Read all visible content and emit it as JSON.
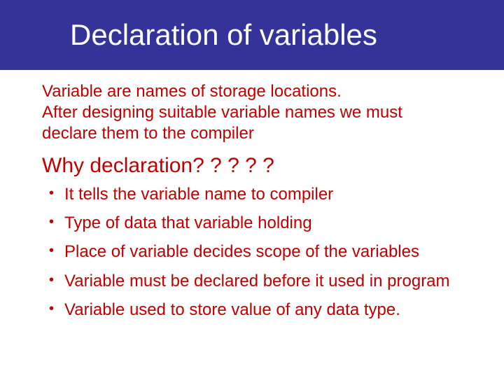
{
  "title": "Declaration of variables",
  "intro": {
    "line1": "Variable are names of storage locations.",
    "line2": "After designing suitable variable names we must declare them to the compiler"
  },
  "subhead": "Why declaration? ? ? ? ?",
  "bullets": [
    "It tells the variable name to compiler",
    "Type of data that variable holding",
    "Place of variable decides scope of the variables",
    "Variable must be declared before it used in program",
    "Variable used to store value of any data type."
  ]
}
